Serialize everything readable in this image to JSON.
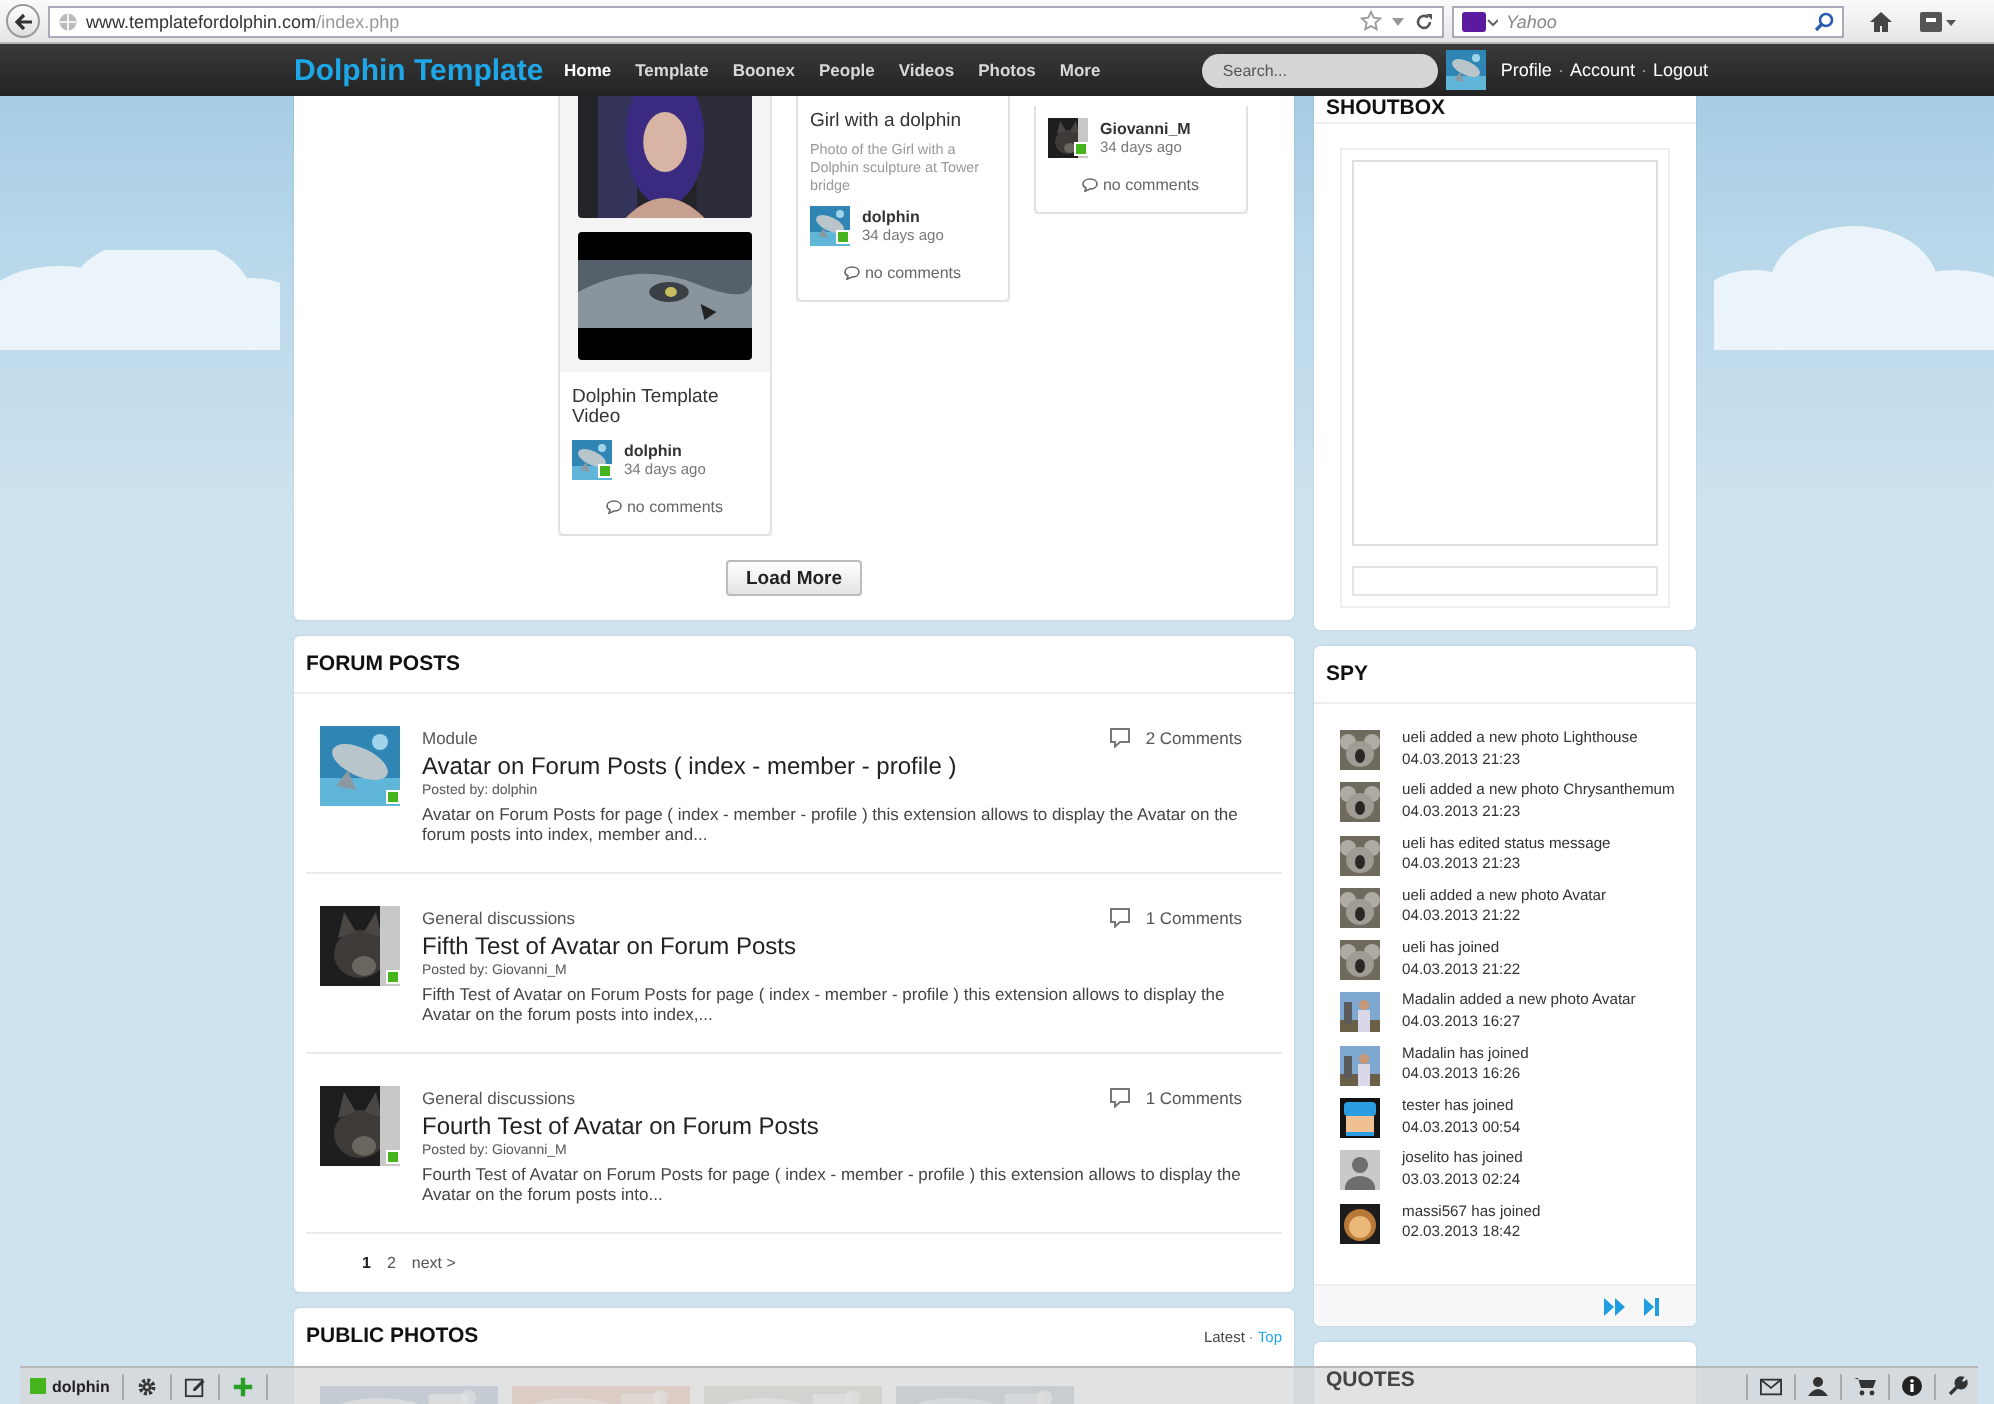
{
  "browser": {
    "url_domain": "www.templatefordolphin.com",
    "url_path": "/index.php",
    "search_placeholder": "Yahoo"
  },
  "site": {
    "logo": "Dolphin Template",
    "search_placeholder": "Search...",
    "nav": [
      {
        "label": "Home",
        "selected": true
      },
      {
        "label": "Template",
        "selected": false
      },
      {
        "label": "Boonex",
        "selected": false
      },
      {
        "label": "People",
        "selected": false
      },
      {
        "label": "Videos",
        "selected": false
      },
      {
        "label": "Photos",
        "selected": false
      },
      {
        "label": "More",
        "selected": false
      }
    ],
    "user_menu": [
      {
        "kind": "link",
        "label": "Profile"
      },
      {
        "kind": "separator",
        "label": "·"
      },
      {
        "kind": "link",
        "label": "Account"
      },
      {
        "kind": "separator",
        "label": "·"
      },
      {
        "kind": "link",
        "label": "Logout"
      }
    ]
  },
  "media": {
    "load_more": "Load More",
    "items": [
      {
        "kind": "video",
        "title": "Dolphin Template Video",
        "author": "dolphin",
        "online": true,
        "time": "34 days ago",
        "comments": "no comments"
      },
      {
        "title": "Girl with a dolphin",
        "description": "Photo of the Girl with a Dolphin sculpture at Tower bridge",
        "author": "dolphin",
        "online": true,
        "time": "34 days ago",
        "comments": "no comments"
      },
      {
        "kind": "cut",
        "author": "Giovanni_M",
        "online": true,
        "time": "34 days ago",
        "comments": "no comments"
      }
    ]
  },
  "shoutbox": {
    "title": "SHOUTBOX"
  },
  "forum_posts": {
    "title": "FORUM POSTS",
    "next": "next >",
    "posts": [
      {
        "category": "Module",
        "title": "Avatar on Forum Posts ( index - member - profile )",
        "posted_by": "Posted by: dolphin",
        "online": true,
        "excerpt": "Avatar on Forum Posts for page ( index - member - profile ) this extension allows to display the Avatar on the forum posts into index, member and...",
        "comments": "2 Comments"
      },
      {
        "category": "General discussions",
        "title": "Fifth Test of Avatar on Forum Posts",
        "posted_by": "Posted by: Giovanni_M",
        "online": true,
        "excerpt": "Fifth Test of Avatar on Forum Posts for page ( index - member - profile ) this extension allows to display the Avatar on the forum posts into index,...",
        "comments": "1 Comments"
      },
      {
        "category": "General discussions",
        "title": "Fourth Test of Avatar on Forum Posts",
        "posted_by": "Posted by: Giovanni_M",
        "online": true,
        "excerpt": "Fourth Test of Avatar on Forum Posts for page ( index - member - profile ) this extension allows to display the Avatar on the forum posts into...",
        "comments": "1 Comments"
      }
    ],
    "pages": [
      {
        "label": "1",
        "selected": true
      },
      {
        "label": "2",
        "selected": false
      }
    ]
  },
  "spy": {
    "title": "SPY",
    "events": [
      {
        "text": "ueli added a new photo Lighthouse",
        "time": "04.03.2013 21:23"
      },
      {
        "text": "ueli added a new photo Chrysanthemum",
        "time": "04.03.2013 21:23"
      },
      {
        "text": "ueli has edited status message",
        "time": "04.03.2013 21:23"
      },
      {
        "text": "ueli added a new photo Avatar",
        "time": "04.03.2013 21:22"
      },
      {
        "text": "ueli has joined",
        "time": "04.03.2013 21:22"
      },
      {
        "text": "Madalin added a new photo Avatar",
        "time": "04.03.2013 16:27"
      },
      {
        "text": "Madalin has joined",
        "time": "04.03.2013 16:26"
      },
      {
        "text": "tester has joined",
        "time": "04.03.2013 00:54"
      },
      {
        "text": "joselito has joined",
        "time": "03.03.2013 02:24"
      },
      {
        "text": "massi567 has joined",
        "time": "02.03.2013 18:42"
      }
    ]
  },
  "public_photos": {
    "title": "PUBLIC PHOTOS",
    "separator": "·",
    "sort": [
      {
        "label": "Latest",
        "selected": true
      },
      {
        "label": "Top",
        "selected": false
      }
    ]
  },
  "quotes": {
    "title": "QUOTES"
  },
  "toolbar": {
    "user": "dolphin",
    "online": true
  }
}
